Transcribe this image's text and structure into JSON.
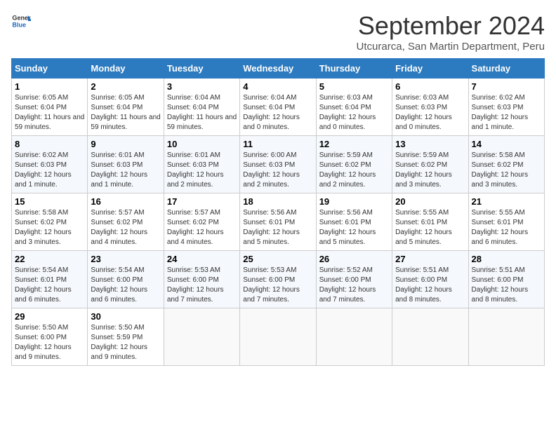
{
  "logo": {
    "general": "General",
    "blue": "Blue"
  },
  "title": "September 2024",
  "subtitle": "Utcurarca, San Martin Department, Peru",
  "weekdays": [
    "Sunday",
    "Monday",
    "Tuesday",
    "Wednesday",
    "Thursday",
    "Friday",
    "Saturday"
  ],
  "weeks": [
    [
      {
        "day": "1",
        "sunrise": "Sunrise: 6:05 AM",
        "sunset": "Sunset: 6:04 PM",
        "daylight": "Daylight: 11 hours and 59 minutes."
      },
      {
        "day": "2",
        "sunrise": "Sunrise: 6:05 AM",
        "sunset": "Sunset: 6:04 PM",
        "daylight": "Daylight: 11 hours and 59 minutes."
      },
      {
        "day": "3",
        "sunrise": "Sunrise: 6:04 AM",
        "sunset": "Sunset: 6:04 PM",
        "daylight": "Daylight: 11 hours and 59 minutes."
      },
      {
        "day": "4",
        "sunrise": "Sunrise: 6:04 AM",
        "sunset": "Sunset: 6:04 PM",
        "daylight": "Daylight: 12 hours and 0 minutes."
      },
      {
        "day": "5",
        "sunrise": "Sunrise: 6:03 AM",
        "sunset": "Sunset: 6:04 PM",
        "daylight": "Daylight: 12 hours and 0 minutes."
      },
      {
        "day": "6",
        "sunrise": "Sunrise: 6:03 AM",
        "sunset": "Sunset: 6:03 PM",
        "daylight": "Daylight: 12 hours and 0 minutes."
      },
      {
        "day": "7",
        "sunrise": "Sunrise: 6:02 AM",
        "sunset": "Sunset: 6:03 PM",
        "daylight": "Daylight: 12 hours and 1 minute."
      }
    ],
    [
      {
        "day": "8",
        "sunrise": "Sunrise: 6:02 AM",
        "sunset": "Sunset: 6:03 PM",
        "daylight": "Daylight: 12 hours and 1 minute."
      },
      {
        "day": "9",
        "sunrise": "Sunrise: 6:01 AM",
        "sunset": "Sunset: 6:03 PM",
        "daylight": "Daylight: 12 hours and 1 minute."
      },
      {
        "day": "10",
        "sunrise": "Sunrise: 6:01 AM",
        "sunset": "Sunset: 6:03 PM",
        "daylight": "Daylight: 12 hours and 2 minutes."
      },
      {
        "day": "11",
        "sunrise": "Sunrise: 6:00 AM",
        "sunset": "Sunset: 6:03 PM",
        "daylight": "Daylight: 12 hours and 2 minutes."
      },
      {
        "day": "12",
        "sunrise": "Sunrise: 5:59 AM",
        "sunset": "Sunset: 6:02 PM",
        "daylight": "Daylight: 12 hours and 2 minutes."
      },
      {
        "day": "13",
        "sunrise": "Sunrise: 5:59 AM",
        "sunset": "Sunset: 6:02 PM",
        "daylight": "Daylight: 12 hours and 3 minutes."
      },
      {
        "day": "14",
        "sunrise": "Sunrise: 5:58 AM",
        "sunset": "Sunset: 6:02 PM",
        "daylight": "Daylight: 12 hours and 3 minutes."
      }
    ],
    [
      {
        "day": "15",
        "sunrise": "Sunrise: 5:58 AM",
        "sunset": "Sunset: 6:02 PM",
        "daylight": "Daylight: 12 hours and 3 minutes."
      },
      {
        "day": "16",
        "sunrise": "Sunrise: 5:57 AM",
        "sunset": "Sunset: 6:02 PM",
        "daylight": "Daylight: 12 hours and 4 minutes."
      },
      {
        "day": "17",
        "sunrise": "Sunrise: 5:57 AM",
        "sunset": "Sunset: 6:02 PM",
        "daylight": "Daylight: 12 hours and 4 minutes."
      },
      {
        "day": "18",
        "sunrise": "Sunrise: 5:56 AM",
        "sunset": "Sunset: 6:01 PM",
        "daylight": "Daylight: 12 hours and 5 minutes."
      },
      {
        "day": "19",
        "sunrise": "Sunrise: 5:56 AM",
        "sunset": "Sunset: 6:01 PM",
        "daylight": "Daylight: 12 hours and 5 minutes."
      },
      {
        "day": "20",
        "sunrise": "Sunrise: 5:55 AM",
        "sunset": "Sunset: 6:01 PM",
        "daylight": "Daylight: 12 hours and 5 minutes."
      },
      {
        "day": "21",
        "sunrise": "Sunrise: 5:55 AM",
        "sunset": "Sunset: 6:01 PM",
        "daylight": "Daylight: 12 hours and 6 minutes."
      }
    ],
    [
      {
        "day": "22",
        "sunrise": "Sunrise: 5:54 AM",
        "sunset": "Sunset: 6:01 PM",
        "daylight": "Daylight: 12 hours and 6 minutes."
      },
      {
        "day": "23",
        "sunrise": "Sunrise: 5:54 AM",
        "sunset": "Sunset: 6:00 PM",
        "daylight": "Daylight: 12 hours and 6 minutes."
      },
      {
        "day": "24",
        "sunrise": "Sunrise: 5:53 AM",
        "sunset": "Sunset: 6:00 PM",
        "daylight": "Daylight: 12 hours and 7 minutes."
      },
      {
        "day": "25",
        "sunrise": "Sunrise: 5:53 AM",
        "sunset": "Sunset: 6:00 PM",
        "daylight": "Daylight: 12 hours and 7 minutes."
      },
      {
        "day": "26",
        "sunrise": "Sunrise: 5:52 AM",
        "sunset": "Sunset: 6:00 PM",
        "daylight": "Daylight: 12 hours and 7 minutes."
      },
      {
        "day": "27",
        "sunrise": "Sunrise: 5:51 AM",
        "sunset": "Sunset: 6:00 PM",
        "daylight": "Daylight: 12 hours and 8 minutes."
      },
      {
        "day": "28",
        "sunrise": "Sunrise: 5:51 AM",
        "sunset": "Sunset: 6:00 PM",
        "daylight": "Daylight: 12 hours and 8 minutes."
      }
    ],
    [
      {
        "day": "29",
        "sunrise": "Sunrise: 5:50 AM",
        "sunset": "Sunset: 6:00 PM",
        "daylight": "Daylight: 12 hours and 9 minutes."
      },
      {
        "day": "30",
        "sunrise": "Sunrise: 5:50 AM",
        "sunset": "Sunset: 5:59 PM",
        "daylight": "Daylight: 12 hours and 9 minutes."
      },
      null,
      null,
      null,
      null,
      null
    ]
  ]
}
